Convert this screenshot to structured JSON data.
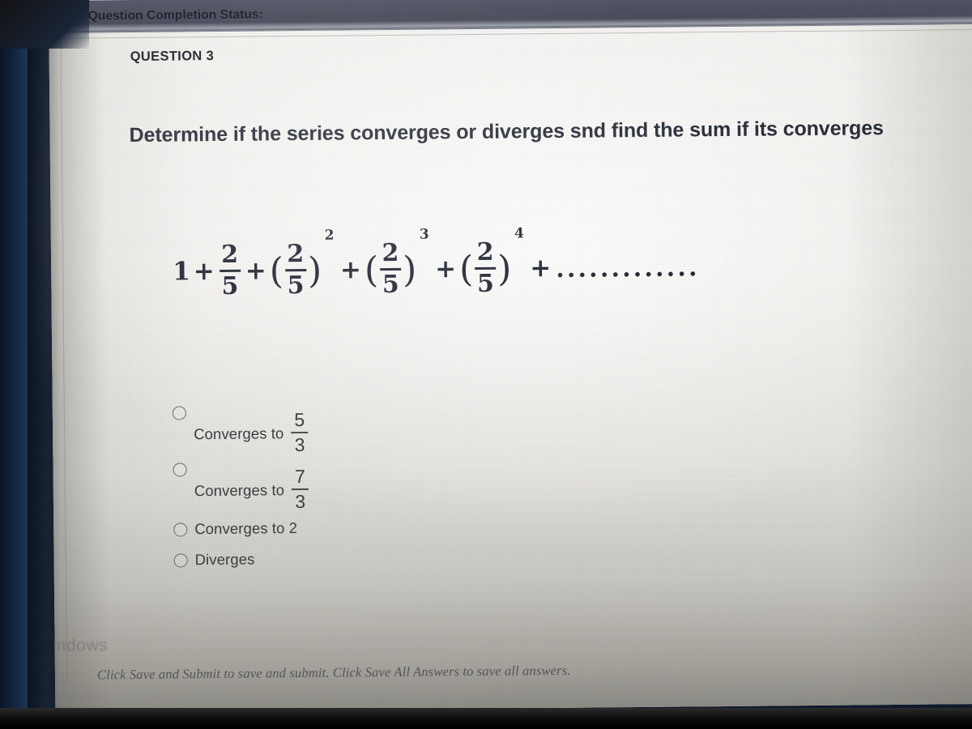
{
  "header": {
    "chevron_icon": "chevron-down-icon",
    "status_label": "Question Completion Status:"
  },
  "question": {
    "number_label": "QUESTION 3",
    "prompt": "Determine if the series converges or diverges snd find the sum if its converges",
    "expression_plain": "1 + 2/5 + (2/5)^2 + (2/5)^3 + (2/5)^4 + ............",
    "expression": {
      "first_term": "1",
      "plus": "+",
      "open_paren": "(",
      "close_paren": ")",
      "numerator": "2",
      "denominator": "5",
      "exponents": [
        "2",
        "3",
        "4"
      ],
      "ellipsis": "............."
    }
  },
  "answers": [
    {
      "id": "option-a",
      "label": "Converges to",
      "value_type": "fraction",
      "numerator": "5",
      "denominator": "3",
      "selected": false
    },
    {
      "id": "option-b",
      "label": "Converges to",
      "value_type": "fraction",
      "numerator": "7",
      "denominator": "3",
      "selected": false
    },
    {
      "id": "option-c",
      "label": "Converges to 2",
      "value_type": "text",
      "selected": false
    },
    {
      "id": "option-d",
      "label": "Diverges",
      "value_type": "text",
      "selected": false
    }
  ],
  "footer": {
    "watermark": "ndows   ",
    "note": "Click Save and Submit to save and submit. Click Save All Answers to save all answers."
  },
  "colors": {
    "header_bar": "#4c505f",
    "page": "#efeeea",
    "text_dark": "#2b2f3a",
    "text_body": "#3b3d41",
    "bezel": "#132541"
  }
}
